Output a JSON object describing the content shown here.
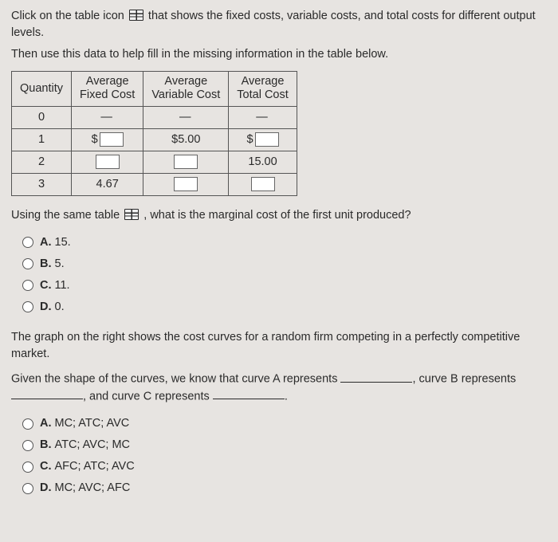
{
  "intro1a": "Click on the table icon",
  "intro1b": "that shows the fixed costs, variable costs, and total costs for different output levels.",
  "intro2": "Then use this data to help fill in the missing information in the table below.",
  "table": {
    "headers": {
      "qty": "Quantity",
      "afc_l1": "Average",
      "afc_l2": "Fixed Cost",
      "avc_l1": "Average",
      "avc_l2": "Variable Cost",
      "atc_l1": "Average",
      "atc_l2": "Total Cost"
    },
    "rows": {
      "r0": {
        "qty": "0",
        "afc": "—",
        "avc": "—",
        "atc": "—"
      },
      "r1": {
        "qty": "1",
        "afc_prefix": "$",
        "avc": "$5.00",
        "atc_prefix": "$"
      },
      "r2": {
        "qty": "2",
        "atc": "15.00"
      },
      "r3": {
        "qty": "3",
        "afc": "4.67"
      }
    }
  },
  "q1_a": "Using the same table",
  "q1_b": ", what is the marginal cost of the first unit produced?",
  "q1_choices": {
    "a": {
      "letter": "A.",
      "text": "15."
    },
    "b": {
      "letter": "B.",
      "text": "5."
    },
    "c": {
      "letter": "C.",
      "text": "11."
    },
    "d": {
      "letter": "D.",
      "text": "0."
    }
  },
  "q2_intro": "The graph on the right shows the cost curves for a random firm competing in a perfectly competitive market.",
  "q2_lead": "Given the shape of the curves, we know that curve A represents",
  "q2_mid1": ", curve B represents",
  "q2_mid2": ", and curve C represents",
  "q2_end": ".",
  "q2_choices": {
    "a": {
      "letter": "A.",
      "text": "MC; ATC; AVC"
    },
    "b": {
      "letter": "B.",
      "text": "ATC; AVC; MC"
    },
    "c": {
      "letter": "C.",
      "text": "AFC; ATC; AVC"
    },
    "d": {
      "letter": "D.",
      "text": "MC; AVC; AFC"
    }
  }
}
